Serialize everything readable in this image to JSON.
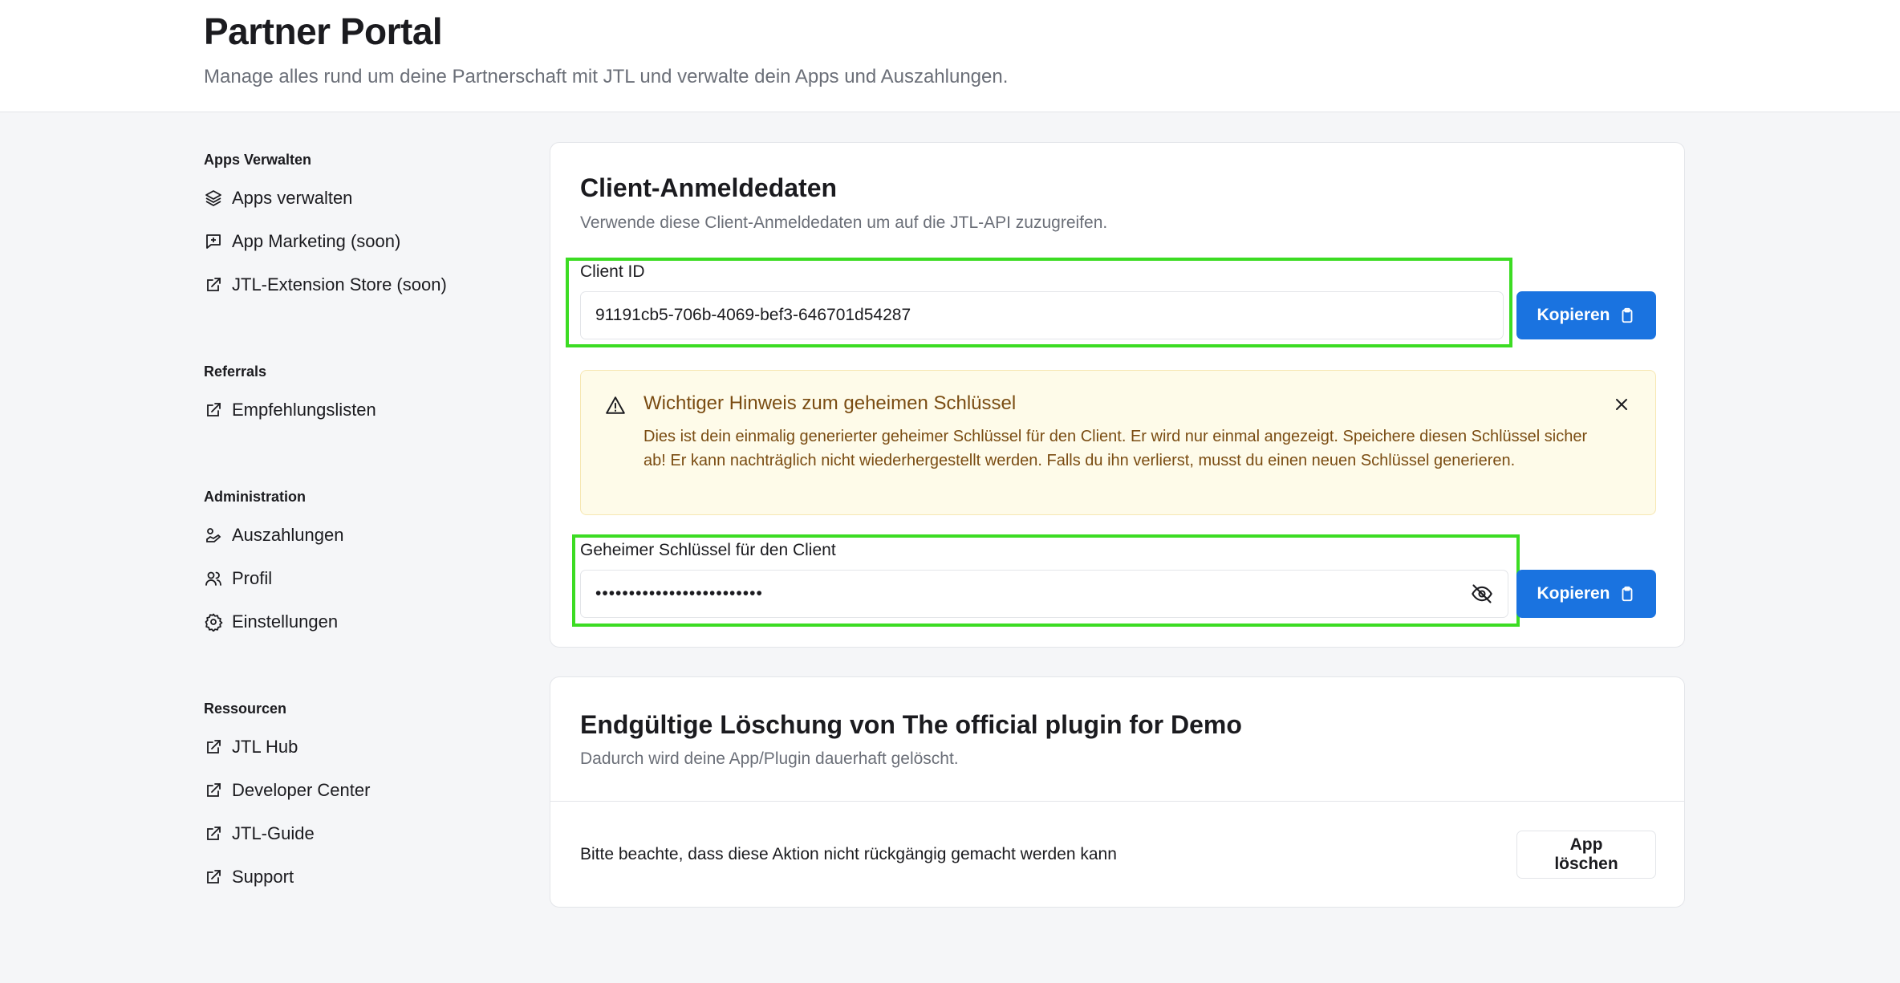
{
  "header": {
    "title": "Partner Portal",
    "subtitle": "Manage alles rund um deine Partnerschaft mit JTL und verwalte dein Apps und Auszahlungen."
  },
  "sidebar": {
    "sections": [
      {
        "title": "Apps Verwalten",
        "items": [
          {
            "label": "Apps verwalten",
            "icon": "layers-icon"
          },
          {
            "label": "App Marketing (soon)",
            "icon": "message-plus-icon"
          },
          {
            "label": "JTL-Extension Store (soon)",
            "icon": "external-link-icon"
          }
        ]
      },
      {
        "title": "Referrals",
        "items": [
          {
            "label": "Empfehlungslisten",
            "icon": "external-link-icon"
          }
        ]
      },
      {
        "title": "Administration",
        "items": [
          {
            "label": "Auszahlungen",
            "icon": "payout-icon"
          },
          {
            "label": "Profil",
            "icon": "users-icon"
          },
          {
            "label": "Einstellungen",
            "icon": "gear-icon"
          }
        ]
      },
      {
        "title": "Ressourcen",
        "items": [
          {
            "label": "JTL Hub",
            "icon": "external-link-icon"
          },
          {
            "label": "Developer Center",
            "icon": "external-link-icon"
          },
          {
            "label": "JTL-Guide",
            "icon": "external-link-icon"
          },
          {
            "label": "Support",
            "icon": "external-link-icon"
          }
        ]
      }
    ]
  },
  "credentials": {
    "title": "Client-Anmeldedaten",
    "description": "Verwende diese Client-Anmeldedaten um auf die JTL-API zuzugreifen.",
    "client_id_label": "Client ID",
    "client_id_value": "91191cb5-706b-4069-bef3-646701d54287",
    "copy_label": "Kopieren",
    "alert": {
      "title": "Wichtiger Hinweis zum geheimen Schlüssel",
      "body": "Dies ist dein einmalig generierter geheimer Schlüssel für den Client. Er wird nur einmal angezeigt. Speichere diesen Schlüssel sicher ab! Er kann nachträglich nicht wiederhergestellt werden. Falls du ihn verlierst, musst du einen neuen Schlüssel generieren."
    },
    "secret_label": "Geheimer Schlüssel für den Client",
    "secret_value": "•••••••••••••••••••••••••"
  },
  "delete": {
    "title": "Endgültige Löschung von The official plugin for Demo",
    "description": "Dadurch wird deine App/Plugin dauerhaft gelöscht.",
    "warning": "Bitte beachte, dass diese Aktion nicht rückgängig gemacht werden kann",
    "button_label": "App löschen"
  },
  "colors": {
    "primary": "#1a73e0",
    "highlight": "#3cdc23",
    "alert_bg": "#fefbe9",
    "alert_text": "#7a4c12"
  }
}
